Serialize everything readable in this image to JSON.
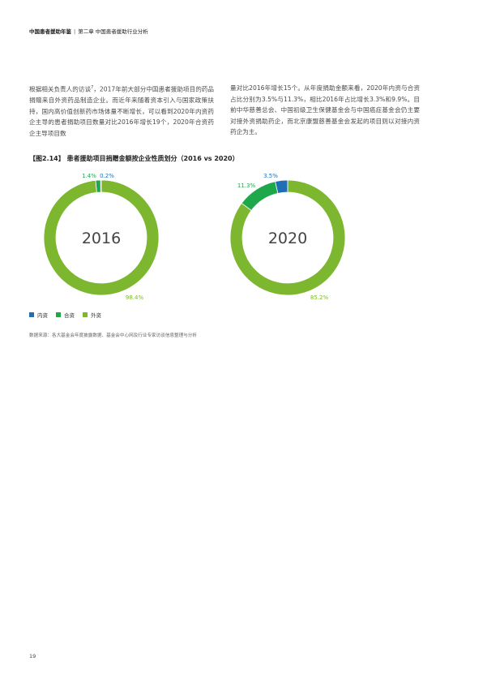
{
  "header": {
    "book_title": "中国患者援助年鉴",
    "separator": "|",
    "chapter": "第二章 中国患者援助行业分析"
  },
  "body": {
    "left_para_a": "根据相关负责人的访谈",
    "left_para_note": "7",
    "left_para_b": "，2017年前大部分中国患者援助项目的药品捐赠来自外资药品制造企业。而近年来随着资本引入与国家政策扶持，国内高价值创新药市场体量不断增长，可以看到2020年内资药企主导的患者捐助项目数量对比2016年增长19个，2020年合资药企主导项目数",
    "right_para": "量对比2016年增长15个。从年度捐助金额来看，2020年内资与合资占比分别为3.5%与11.3%，相比2016年占比增长3.3%和9.9%。目前中华慈善总会、中国初级卫生保健基金会与中国癌症基金会仍主要对接外资捐助药企，而北京康盟慈善基金会发起的项目则以对接内资药企为主。"
  },
  "figure": {
    "title": "【图2.14】 患者援助项目捐赠金额按企业性质划分（2016 vs 2020）"
  },
  "colors": {
    "domestic": "#1f6fb7",
    "joint": "#1fa84a",
    "foreign": "#7db72f"
  },
  "chart_data": [
    {
      "type": "pie",
      "style": "donut",
      "center_label": "2016",
      "series": [
        {
          "name": "内资",
          "value": 0.2,
          "label": "0.2%"
        },
        {
          "name": "合资",
          "value": 1.4,
          "label": "1.4%"
        },
        {
          "name": "外资",
          "value": 98.4,
          "label": "98.4%"
        }
      ]
    },
    {
      "type": "pie",
      "style": "donut",
      "center_label": "2020",
      "series": [
        {
          "name": "内资",
          "value": 3.5,
          "label": "3.5%"
        },
        {
          "name": "合资",
          "value": 11.3,
          "label": "11.3%"
        },
        {
          "name": "外资",
          "value": 85.2,
          "label": "85.2%"
        }
      ]
    }
  ],
  "legend": {
    "items": [
      "内资",
      "合资",
      "外资"
    ],
    "placement": "bottom-left"
  },
  "source": "数据来源：各大基金会年度披露数据、基金会中心网及行业专家访谈信息整理与分析",
  "page_number": "19"
}
